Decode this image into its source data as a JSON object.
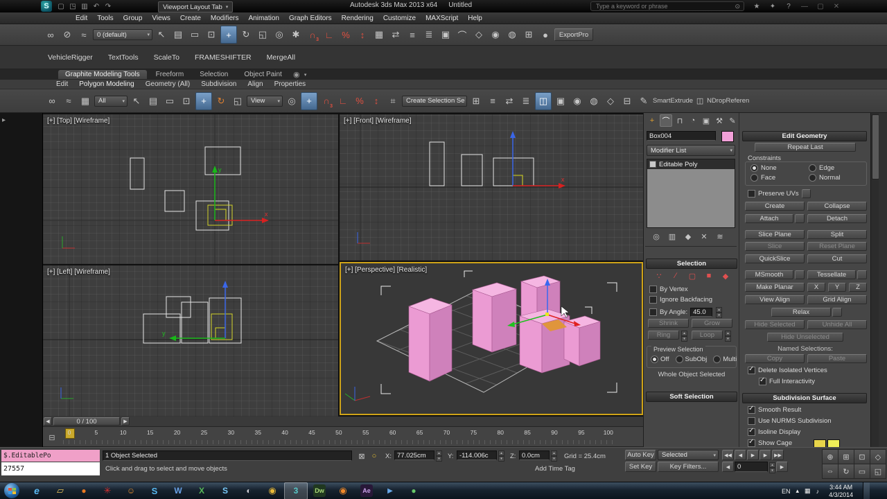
{
  "window": {
    "app_title": "Autodesk 3ds Max 2013 x64",
    "doc_title": "Untitled",
    "viewport_layout_tab": "Viewport Layout Tab",
    "search_placeholder": "Type a keyword or phrase"
  },
  "menus": [
    "Edit",
    "Tools",
    "Group",
    "Views",
    "Create",
    "Modifiers",
    "Animation",
    "Graph Editors",
    "Rendering",
    "Customize",
    "MAXScript",
    "Help"
  ],
  "main_toolbar": {
    "layer_dropdown": "0 (default)",
    "export_button": "ExportPro"
  },
  "scripts_toolbar": [
    "VehicleRigger",
    "TextTools",
    "ScaleTo",
    "FRAMESHIFTER",
    "MergeAll"
  ],
  "ribbon": {
    "tabs": [
      "Graphite Modeling Tools",
      "Freeform",
      "Selection",
      "Object Paint"
    ],
    "subtabs": [
      "Edit",
      "Polygon Modeling",
      "Geometry (All)",
      "Subdivision",
      "Align",
      "Properties"
    ],
    "all_dropdown": "All",
    "view_dropdown": "View",
    "selection_set_dropdown": "Create Selection Se",
    "smart_extrude": "SmartExtrude",
    "drop_reference": "NDropReferen"
  },
  "viewports": {
    "top": "[+] [Top] [Wireframe]",
    "front": "[+] [Front] [Wireframe]",
    "left": "[+] [Left] [Wireframe]",
    "perspective": "[+] [Perspective] [Realistic]",
    "axis_x": "x",
    "axis_y": "y"
  },
  "command_panel": {
    "object_name": "Box004",
    "modifier_list": "Modifier List",
    "stack_item": "Editable Poly",
    "selection": {
      "title": "Selection",
      "by_vertex": "By Vertex",
      "ignore_backfacing": "Ignore Backfacing",
      "by_angle": "By Angle:",
      "by_angle_value": "45.0",
      "shrink": "Shrink",
      "grow": "Grow",
      "ring": "Ring",
      "loop": "Loop",
      "preview_selection": "Preview Selection",
      "off": "Off",
      "subobj": "SubObj",
      "multi": "Multi",
      "status": "Whole Object Selected"
    },
    "soft_selection": "Soft Selection"
  },
  "edit_geometry": {
    "title": "Edit Geometry",
    "repeat_last": "Repeat Last",
    "constraints": "Constraints",
    "constraint_none": "None",
    "constraint_edge": "Edge",
    "constraint_face": "Face",
    "constraint_normal": "Normal",
    "preserve_uvs": "Preserve UVs",
    "create": "Create",
    "collapse": "Collapse",
    "attach": "Attach",
    "detach": "Detach",
    "slice_plane": "Slice Plane",
    "split": "Split",
    "slice": "Slice",
    "reset_plane": "Reset Plane",
    "quickslice": "QuickSlice",
    "cut": "Cut",
    "msmooth": "MSmooth",
    "tessellate": "Tessellate",
    "make_planar": "Make Planar",
    "x": "X",
    "y": "Y",
    "z": "Z",
    "view_align": "View Align",
    "grid_align": "Grid Align",
    "relax": "Relax",
    "hide_selected": "Hide Selected",
    "unhide_all": "Unhide All",
    "hide_unselected": "Hide Unselected",
    "named_selections": "Named Selections:",
    "copy": "Copy",
    "paste": "Paste",
    "delete_isolated": "Delete Isolated Vertices",
    "full_interactivity": "Full Interactivity"
  },
  "subdivision_surface": {
    "title": "Subdivision Surface",
    "smooth_result": "Smooth Result",
    "use_nurms": "Use NURMS Subdivision",
    "isoline_display": "Isoline Display",
    "show_cage": "Show Cage"
  },
  "timeline": {
    "slider": "0 / 100",
    "ticks": [
      "0",
      "5",
      "10",
      "15",
      "20",
      "25",
      "30",
      "35",
      "40",
      "45",
      "50",
      "55",
      "60",
      "65",
      "70",
      "75",
      "80",
      "85",
      "90",
      "95",
      "100"
    ]
  },
  "status_bar": {
    "listener_input": "$.EditablePo",
    "listener_output": "27557",
    "selection_status": "1 Object Selected",
    "prompt": "Click and drag to select and move objects",
    "x_label": "X:",
    "x_value": "77.025cm",
    "y_label": "Y:",
    "y_value": "-114.006c",
    "z_label": "Z:",
    "z_value": "0.0cm",
    "grid_value": "Grid = 25.4cm",
    "add_time_tag": "Add Time Tag",
    "auto_key": "Auto Key",
    "set_key": "Set Key",
    "key_mode_dropdown": "Selected",
    "key_filters": "Key Filters...",
    "frame_number": "0"
  },
  "taskbar": {
    "language": "EN",
    "time": "3:44 AM",
    "date": "4/3/2014",
    "apps": [
      {
        "name": "internet-explorer",
        "glyph": "e",
        "css": "color:#5ab8f2;font-size:14px;font-style:italic;font-weight:bold"
      },
      {
        "name": "folder",
        "glyph": "▱",
        "css": "color:#e8c35a;font-size:13px"
      },
      {
        "name": "orange-app",
        "glyph": "●",
        "css": "color:#e87820;font-size:12px"
      },
      {
        "name": "pinwheel-app",
        "glyph": "✳",
        "css": "color:#d83030;font-size:13px"
      },
      {
        "name": "character-app",
        "glyph": "☺",
        "css": "color:#e89030;font-size:12px"
      },
      {
        "name": "skype",
        "glyph": "S",
        "css": "color:#58b8f0;font-weight:bold;font-size:13px"
      },
      {
        "name": "word",
        "glyph": "W",
        "css": "color:#6aa2e8;font-weight:bold;font-size:12px"
      },
      {
        "name": "excel",
        "glyph": "X",
        "css": "color:#58b858;font-weight:bold;font-size:12px"
      },
      {
        "name": "messenger",
        "glyph": "S",
        "css": "color:#78c8f8;font-weight:bold;font-size:12px"
      },
      {
        "name": "steam",
        "glyph": "◐",
        "css": "color:#c8c8d0;font-size:12px"
      },
      {
        "name": "chrome",
        "glyph": "◉",
        "css": "color:#e8b838;font-size:13px"
      },
      {
        "name": "3ds-max",
        "glyph": "3",
        "css": "color:#58c8c8;font-weight:bold;font-size:12px"
      },
      {
        "name": "dreamweaver",
        "glyph": "Dw",
        "css": "background:#203820;color:#a8d878;border-radius:3px;font-size:9px;font-weight:bold;width:18px;height:18px"
      },
      {
        "name": "firefox",
        "glyph": "◉",
        "css": "color:#f08828;font-size:13px"
      },
      {
        "name": "after-effects",
        "glyph": "Ae",
        "css": "background:#281838;color:#c8a0e8;border-radius:3px;font-size:9px;font-weight:bold;width:18px;height:18px"
      },
      {
        "name": "media-player",
        "glyph": "▶",
        "css": "color:#68a8e8;font-size:10px"
      },
      {
        "name": "green-app",
        "glyph": "●",
        "css": "color:#68c868;font-size:12px"
      }
    ]
  },
  "icons": {
    "logo": "S",
    "new_scene": "▢",
    "open_file": "◳",
    "save_file": "▥",
    "undo": "↶",
    "redo": "↷",
    "search": "⊙",
    "favorites": "★",
    "comm": "✦",
    "help": "?",
    "win_min": "—",
    "win_max": "▢",
    "win_close": "✕",
    "select_link": "∞",
    "unlink": "⊘",
    "bind_spacewarp": "≈",
    "select_object": "↖",
    "select_by_name": "▤",
    "rect_region": "▭",
    "window_crossing": "⊡",
    "select_move": "+",
    "select_rotate": "↻",
    "select_scale": "◱",
    "pivot_center": "◎",
    "select_manipulate": "✱",
    "keyboard_override": "⌗",
    "snap_toggle": "∩",
    "snap_sub": "3",
    "angle_snap": "∟",
    "percent_snap": "%",
    "spinner_snap": "↕",
    "edit_named": "▦",
    "mirror": "⇄",
    "align": "≡",
    "layer_manager": "≣",
    "graphite": "▣",
    "curve_editor": "⌒",
    "schematic": "◇",
    "material_editor": "◉",
    "render_setup": "◍",
    "rendered_frame": "⊞",
    "render": "●",
    "pencil": "✎",
    "window": "◫",
    "circle_btn": "◉",
    "layout_tab": "▸",
    "create_tab": "+",
    "modify_tab": "⌒",
    "hierarchy_tab": "⊓",
    "motion_tab": "◔",
    "display_tab": "▣",
    "utilities_tab": "⚒",
    "vertex": "∵",
    "edge": "∕",
    "border": "▢",
    "polygon": "■",
    "element": "◆",
    "pin_stack": "◎",
    "show_end": "▥",
    "make_unique": "◆",
    "remove_mod": "✕",
    "configure": "≋",
    "listener_icon": "⊟",
    "key_icon": "○",
    "lock_icon": "⊠",
    "go_start": "◀◀",
    "key_prev": "◀",
    "play": "▶",
    "key_next": "▶",
    "go_end": "▶▶",
    "prev_frame": "◀",
    "next_frame": "▶",
    "zoom": "⊕",
    "zoom_all": "⊞",
    "zoom_extents": "⊡",
    "fov": "◇",
    "pan": "⇔",
    "orbit": "↻",
    "zoom_region": "▭",
    "max_viewport": "◱",
    "tray_up": "▴",
    "tray_net": "▦",
    "tray_vol": "♪"
  },
  "colors": {
    "active_viewport_border": "#cfa318",
    "object_color": "#f2a0d8",
    "listener_pink": "#f0a0c8",
    "selection_yellow": "#d8d820"
  }
}
